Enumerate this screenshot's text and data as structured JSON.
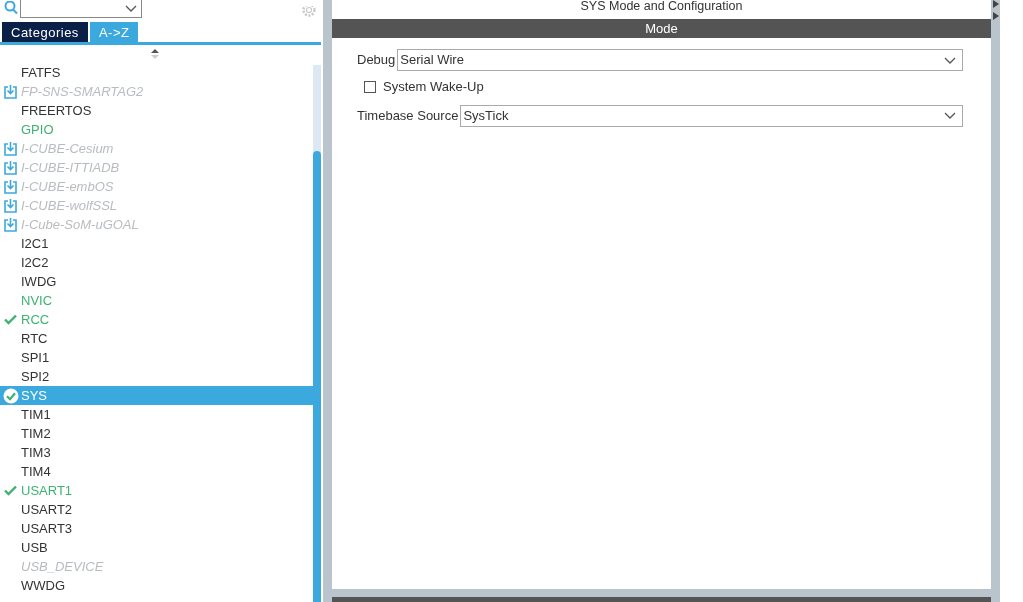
{
  "tabs": [
    {
      "label": "Categories",
      "selected": false
    },
    {
      "label": "A->Z",
      "selected": true
    }
  ],
  "components": [
    {
      "name": "FATFS",
      "kind": "normal",
      "checked": false,
      "selected": false
    },
    {
      "name": "FP-SNS-SMARTAG2",
      "kind": "pack",
      "checked": false,
      "selected": false
    },
    {
      "name": "FREERTOS",
      "kind": "normal",
      "checked": false,
      "selected": false
    },
    {
      "name": "GPIO",
      "kind": "configured",
      "checked": false,
      "selected": false
    },
    {
      "name": "I-CUBE-Cesium",
      "kind": "pack",
      "checked": false,
      "selected": false
    },
    {
      "name": "I-CUBE-ITTIADB",
      "kind": "pack",
      "checked": false,
      "selected": false
    },
    {
      "name": "I-CUBE-embOS",
      "kind": "pack",
      "checked": false,
      "selected": false
    },
    {
      "name": "I-CUBE-wolfSSL",
      "kind": "pack",
      "checked": false,
      "selected": false
    },
    {
      "name": "I-Cube-SoM-uGOAL",
      "kind": "pack",
      "checked": false,
      "selected": false
    },
    {
      "name": "I2C1",
      "kind": "normal",
      "checked": false,
      "selected": false
    },
    {
      "name": "I2C2",
      "kind": "normal",
      "checked": false,
      "selected": false
    },
    {
      "name": "IWDG",
      "kind": "normal",
      "checked": false,
      "selected": false
    },
    {
      "name": "NVIC",
      "kind": "configured",
      "checked": false,
      "selected": false
    },
    {
      "name": "RCC",
      "kind": "configured",
      "checked": true,
      "selected": false
    },
    {
      "name": "RTC",
      "kind": "normal",
      "checked": false,
      "selected": false
    },
    {
      "name": "SPI1",
      "kind": "normal",
      "checked": false,
      "selected": false
    },
    {
      "name": "SPI2",
      "kind": "normal",
      "checked": false,
      "selected": false
    },
    {
      "name": "SYS",
      "kind": "configured",
      "checked": true,
      "selected": true
    },
    {
      "name": "TIM1",
      "kind": "normal",
      "checked": false,
      "selected": false
    },
    {
      "name": "TIM2",
      "kind": "normal",
      "checked": false,
      "selected": false
    },
    {
      "name": "TIM3",
      "kind": "normal",
      "checked": false,
      "selected": false
    },
    {
      "name": "TIM4",
      "kind": "normal",
      "checked": false,
      "selected": false
    },
    {
      "name": "USART1",
      "kind": "configured",
      "checked": true,
      "selected": false
    },
    {
      "name": "USART2",
      "kind": "normal",
      "checked": false,
      "selected": false
    },
    {
      "name": "USART3",
      "kind": "normal",
      "checked": false,
      "selected": false
    },
    {
      "name": "USB",
      "kind": "normal",
      "checked": false,
      "selected": false
    },
    {
      "name": "USB_DEVICE",
      "kind": "disabled",
      "checked": false,
      "selected": false
    },
    {
      "name": "WWDG",
      "kind": "normal",
      "checked": false,
      "selected": false
    }
  ],
  "panel": {
    "title": "SYS Mode and Configuration",
    "section": "Mode",
    "fields": [
      {
        "kind": "select",
        "label": "Debug",
        "value": "Serial Wire"
      },
      {
        "kind": "checkbox",
        "label": "System Wake-Up",
        "checked": false
      },
      {
        "kind": "select",
        "label": "Timebase Source",
        "value": "SysTick"
      }
    ]
  }
}
